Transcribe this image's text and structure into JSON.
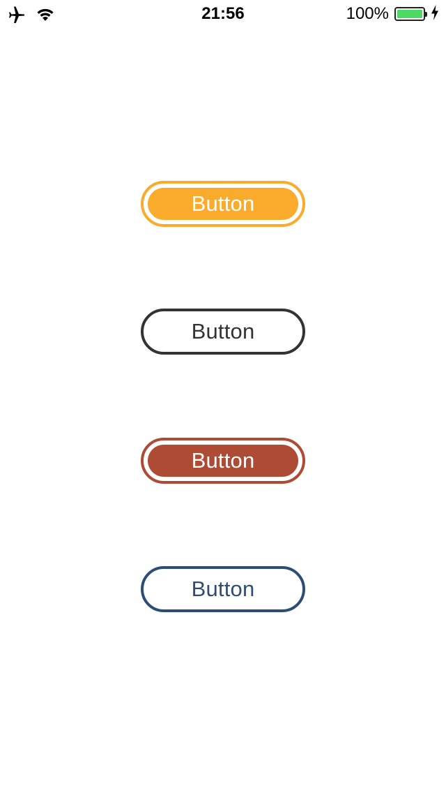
{
  "status_bar": {
    "time": "21:56",
    "battery_percent": "100%",
    "battery_level": 1.0,
    "icons": [
      "airplane-icon",
      "wifi-icon",
      "battery-icon",
      "charging-bolt-icon"
    ]
  },
  "buttons": [
    {
      "label": "Button",
      "style": "filled",
      "color": "#fbab2c"
    },
    {
      "label": "Button",
      "style": "outline",
      "color": "#333333"
    },
    {
      "label": "Button",
      "style": "filled",
      "color": "#ad4b35"
    },
    {
      "label": "Button",
      "style": "outline",
      "color": "#2e4d75"
    }
  ],
  "colors": {
    "background": "#ffffff",
    "battery_fill": "#4cd964"
  }
}
